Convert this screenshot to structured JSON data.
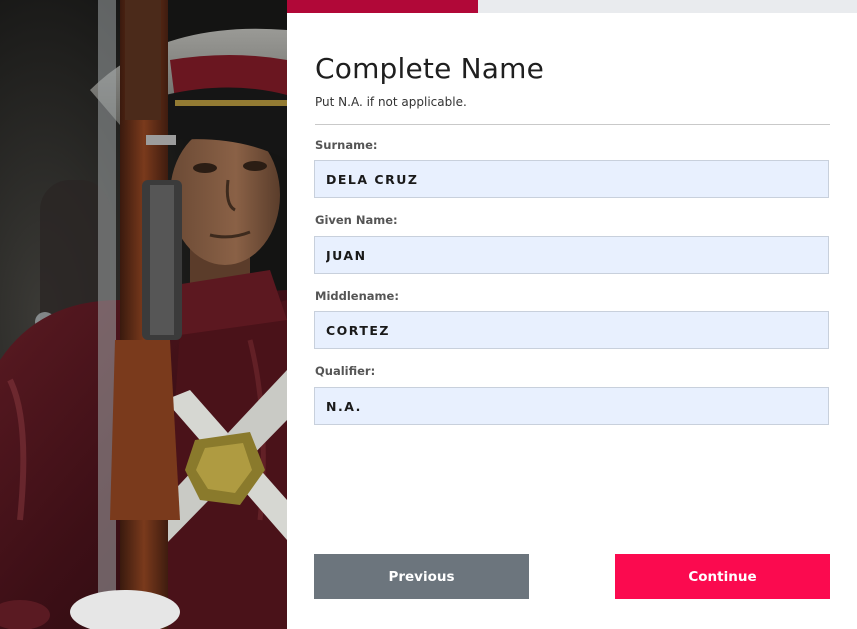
{
  "form": {
    "title": "Complete Name",
    "subtitle": "Put N.A. if not applicable.",
    "progress_fraction": 0.335,
    "colors": {
      "progress_fill": "#b10838",
      "progress_track": "#e9ebee",
      "input_bg": "#e8f0fe",
      "previous_button": "#6c757d",
      "continue_button": "#fb0a4f"
    },
    "fields": [
      {
        "label": "Surname:",
        "value": "DELA CRUZ"
      },
      {
        "label": "Given Name:",
        "value": "JUAN"
      },
      {
        "label": "Middlename:",
        "value": "CORTEZ"
      },
      {
        "label": "Qualifier:",
        "value": "N.A."
      }
    ],
    "buttons": {
      "previous": "Previous",
      "continue": "Continue"
    }
  }
}
